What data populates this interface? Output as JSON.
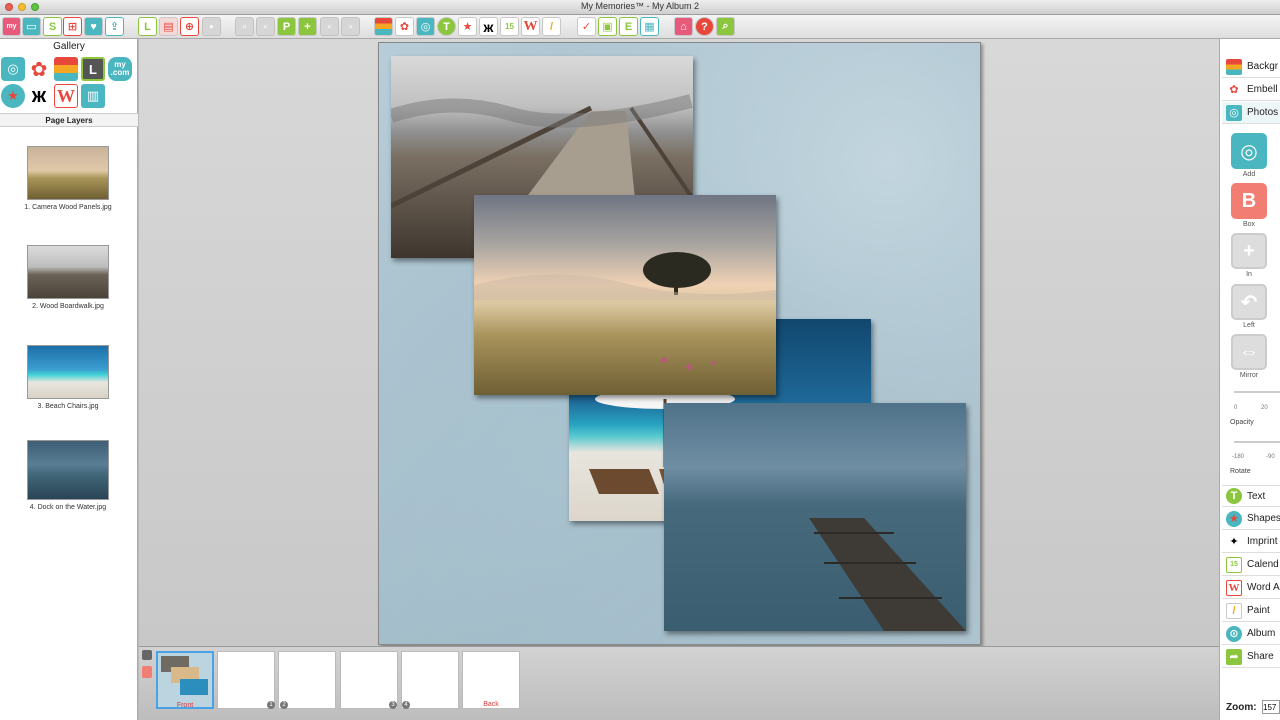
{
  "window": {
    "title": "My Memories™ - My Album 2"
  },
  "toolbar": {
    "groups": [
      {
        "name": "file",
        "icons": [
          "my-memories-logo-icon",
          "folder-icon",
          "s-page-icon",
          "layout-icon",
          "heart-icon",
          "export-icon"
        ]
      },
      {
        "name": "edit",
        "icons": [
          "layout-icon",
          "photo-strip-icon",
          "link-icon"
        ]
      },
      {
        "name": "disabled",
        "icons": [
          "group-icon",
          "ungroup-icon",
          "lock-icon"
        ]
      },
      {
        "name": "pages",
        "icons": [
          "page-plus-icon",
          "page-add-icon"
        ]
      },
      {
        "name": "arrange",
        "icons": [
          "bring-front-icon",
          "send-back-icon",
          "forward-icon",
          "backward-icon"
        ]
      },
      {
        "name": "content",
        "icons": [
          "background-icon",
          "flower-icon",
          "camera-icon",
          "text-icon",
          "butterfly-icon",
          "calendar-icon",
          "word-art-icon",
          "pen-icon"
        ]
      },
      {
        "name": "tools",
        "icons": [
          "check-icon",
          "shadow-icon",
          "e-icon",
          "frame-icon"
        ]
      },
      {
        "name": "extra",
        "icons": [
          "share-icon",
          "help-icon",
          "search-icon"
        ]
      }
    ]
  },
  "left_panel": {
    "gallery_title": "Gallery",
    "gallery_icons": [
      "camera-icon",
      "flower-icon",
      "background-icon",
      "layout-icon",
      "my-com-icon",
      "star-icon",
      "butterfly-icon",
      "word-art-icon",
      "template-icon"
    ],
    "mycom_label": "my .com",
    "layers_title": "Page Layers",
    "layers": [
      {
        "label": "1. Camera Wood Panels.jpg"
      },
      {
        "label": "2. Wood Boardwalk.jpg"
      },
      {
        "label": "3. Beach Chairs.jpg"
      },
      {
        "label": "4. Dock on the Water.jpg"
      }
    ]
  },
  "right_panel": {
    "top_items": [
      {
        "label": "Backgr",
        "icon": "background-icon"
      },
      {
        "label": "Embell",
        "icon": "flower-icon"
      },
      {
        "label": "Photos",
        "icon": "camera-icon"
      }
    ],
    "tools": [
      {
        "label": "Add",
        "icon": "camera-icon",
        "enabled": true
      },
      {
        "label": "Box",
        "icon": "box-icon",
        "glyph": "B",
        "enabled": true
      },
      {
        "label": "In",
        "icon": "zoom-in-icon",
        "enabled": false
      },
      {
        "label": "Left",
        "icon": "rotate-left-icon",
        "enabled": false
      },
      {
        "label": "Mirror",
        "icon": "mirror-icon",
        "enabled": false
      }
    ],
    "opacity": {
      "label": "Opacity",
      "ticks": [
        "0",
        "20"
      ]
    },
    "rotate": {
      "label": "Rotate",
      "ticks": [
        "-180",
        "-90"
      ]
    },
    "bottom_items": [
      {
        "label": "Text",
        "glyph": "T",
        "icon": "text-icon"
      },
      {
        "label": "Shapes",
        "glyph": "★",
        "icon": "shapes-icon"
      },
      {
        "label": "Imprint",
        "glyph": "✦",
        "icon": "butterfly-icon"
      },
      {
        "label": "Calend",
        "glyph": "15",
        "icon": "calendar-icon"
      },
      {
        "label": "Word A",
        "glyph": "W",
        "icon": "word-art-icon"
      },
      {
        "label": "Paint",
        "glyph": "/",
        "icon": "paint-icon"
      },
      {
        "label": "Album",
        "glyph": "⊙",
        "icon": "album-icon"
      },
      {
        "label": "Share",
        "glyph": "➦",
        "icon": "share-icon"
      }
    ],
    "zoom_label": "Zoom:",
    "zoom_value": "157"
  },
  "page_strip": {
    "front_label": "Front",
    "back_label": "Back",
    "page_numbers": [
      "1",
      "2",
      "3",
      "4"
    ]
  },
  "colors": {
    "accent": "#49b6c0",
    "orange": "#f08a4b",
    "green": "#8cc63f",
    "red": "#e8473c"
  }
}
